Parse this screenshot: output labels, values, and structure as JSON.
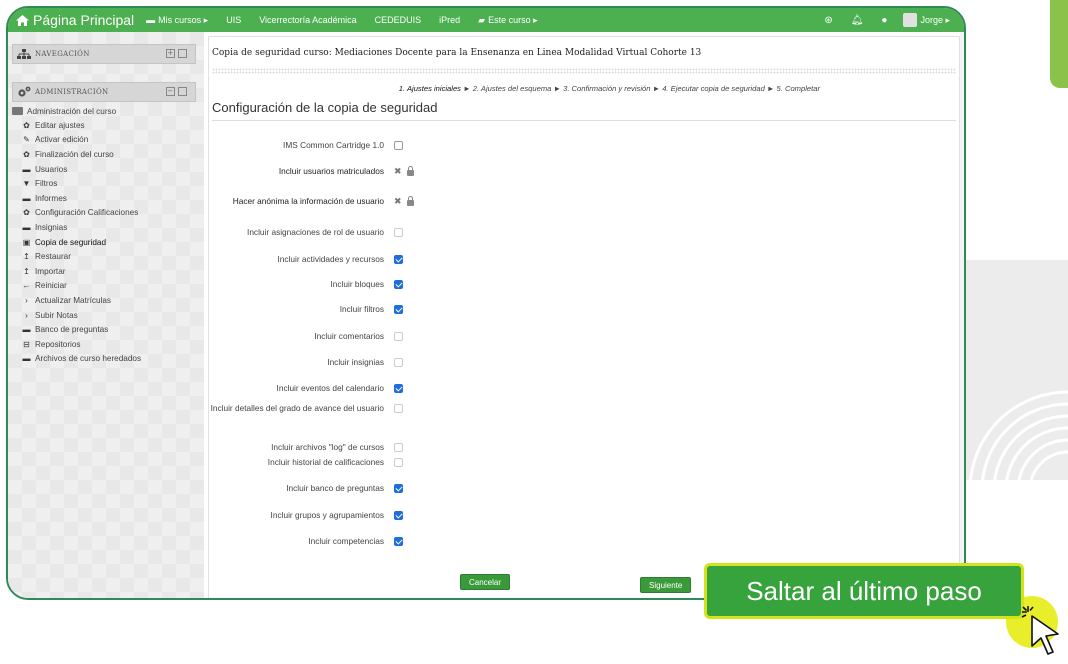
{
  "topbar": {
    "brand": "Página Principal",
    "nav": [
      {
        "label": "Mis cursos ▸",
        "icon": "course-icon"
      },
      {
        "label": "UIS",
        "icon": ""
      },
      {
        "label": "Vicerrectoría Académica",
        "icon": ""
      },
      {
        "label": "CEDEDUIS",
        "icon": ""
      },
      {
        "label": "iPred",
        "icon": ""
      },
      {
        "label": "Este curso ▸",
        "icon": "book-icon"
      }
    ],
    "user": "Jorge ▸"
  },
  "sidebar": {
    "nav_block": "NAVEGACIÓN",
    "admin_block": "ADMINISTRACIÓN",
    "admin_root": "Administración del curso",
    "items": [
      {
        "label": "Editar ajustes",
        "icon": "gear-icon",
        "glyph": "✿"
      },
      {
        "label": "Activar edición",
        "icon": "pencil-icon",
        "glyph": "✎"
      },
      {
        "label": "Finalización del curso",
        "icon": "gear-icon",
        "glyph": "✿"
      },
      {
        "label": "Usuarios",
        "icon": "folder-icon",
        "glyph": "▬"
      },
      {
        "label": "Filtros",
        "icon": "filter-icon",
        "glyph": "▼"
      },
      {
        "label": "Informes",
        "icon": "folder-icon",
        "glyph": "▬"
      },
      {
        "label": "Configuración Calificaciones",
        "icon": "gear-icon",
        "glyph": "✿"
      },
      {
        "label": "Insignias",
        "icon": "folder-icon",
        "glyph": "▬"
      },
      {
        "label": "Copia de seguridad",
        "icon": "backup-icon",
        "glyph": "▣"
      },
      {
        "label": "Restaurar",
        "icon": "upload-icon",
        "glyph": "↥"
      },
      {
        "label": "Importar",
        "icon": "upload-icon",
        "glyph": "↥"
      },
      {
        "label": "Reiniciar",
        "icon": "arrow-left-icon",
        "glyph": "←"
      },
      {
        "label": "Actualizar Matrículas",
        "icon": "chevron-right-icon",
        "glyph": "›"
      },
      {
        "label": "Subir Notas",
        "icon": "chevron-right-icon",
        "glyph": "›"
      },
      {
        "label": "Banco de preguntas",
        "icon": "folder-icon",
        "glyph": "▬"
      },
      {
        "label": "Repositorios",
        "icon": "repository-icon",
        "glyph": "⊟"
      },
      {
        "label": "Archivos de curso heredados",
        "icon": "folder-icon",
        "glyph": "▬"
      }
    ]
  },
  "main": {
    "course_title": "Copia de seguridad curso: Mediaciones Docente para la Ensenanza en Linea Modalidad Virtual Cohorte 13",
    "steps_current": "1. Ajustes iniciales",
    "steps_rest": " ► 2. Ajustes del esquema ► 3. Confirmación y revisión ► 4. Ejecutar copia de seguridad ► 5. Completar",
    "section_title": "Configuración de la copia de seguridad",
    "options": [
      {
        "label": "IMS Common Cartridge 1.0",
        "state": "unchecked"
      },
      {
        "label": "Incluir usuarios matriculados",
        "state": "locked"
      },
      {
        "label": "Hacer anónima la información de usuario",
        "state": "locked"
      },
      {
        "label": "Incluir asignaciones de rol de usuario",
        "state": "disabled"
      },
      {
        "label": "Incluir actividades y recursos",
        "state": "checked"
      },
      {
        "label": "Incluir bloques",
        "state": "checked"
      },
      {
        "label": "Incluir filtros",
        "state": "checked"
      },
      {
        "label": "Incluir comentarios",
        "state": "disabled"
      },
      {
        "label": "Incluir insignias",
        "state": "disabled"
      },
      {
        "label": "Incluir eventos del calendario",
        "state": "checked"
      },
      {
        "label": "Incluir detalles del grado de avance del usuario",
        "state": "disabled"
      },
      {
        "label": "Incluir archivos \"log\" de cursos",
        "state": "disabled"
      },
      {
        "label": "Incluir historial de calificaciones",
        "state": "disabled"
      },
      {
        "label": "Incluir banco de preguntas",
        "state": "checked"
      },
      {
        "label": "Incluir grupos y agrupamientos",
        "state": "checked"
      },
      {
        "label": "Incluir competencias",
        "state": "checked"
      }
    ],
    "cancel": "Cancelar",
    "next": "Siguiente"
  },
  "callout": "Saltar al último paso"
}
